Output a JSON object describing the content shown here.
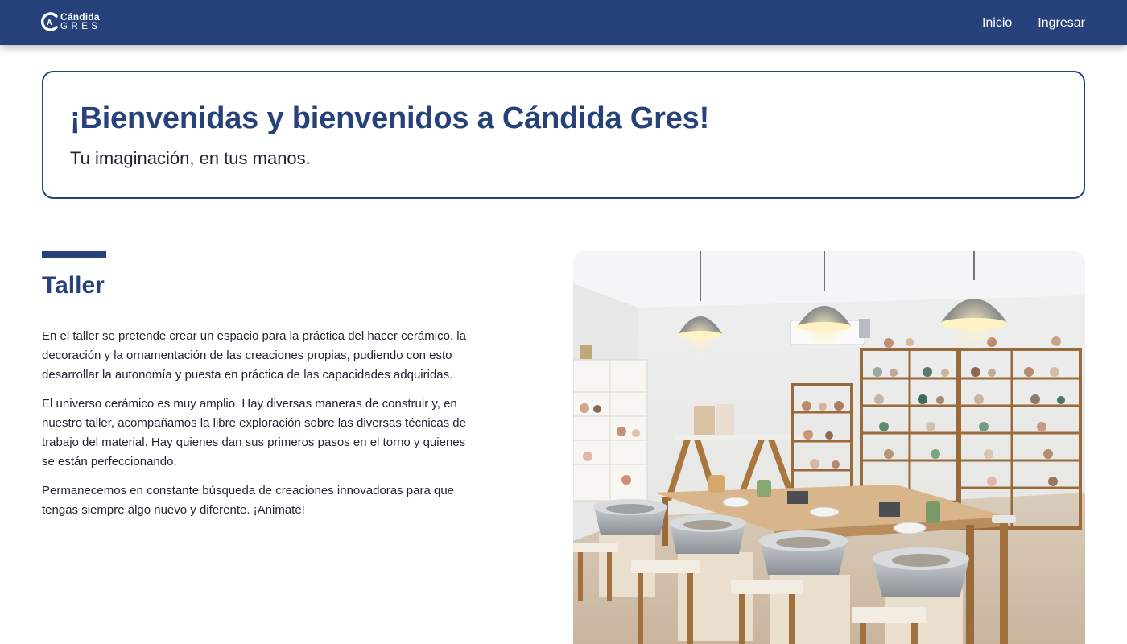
{
  "nav": {
    "logo_name": "Cándida",
    "logo_sub": "GRES",
    "links": [
      "Inicio",
      "Ingresar"
    ]
  },
  "hero": {
    "title": "¡Bienvenidas y bienvenidos a Cándida Gres!",
    "subtitle": "Tu imaginación, en tus manos."
  },
  "section": {
    "title": "Taller",
    "paragraphs": [
      "En el taller se pretende crear un espacio para la práctica del hacer cerámico, la decoración y la ornamentación de las creaciones propias, pudiendo con esto desarrollar la autonomía y puesta en práctica de las capacidades adquiridas.",
      "El universo cerámico es muy amplio. Hay diversas maneras de construir y, en nuestro taller, acompañamos la libre exploración sobre las diversas técnicas de trabajo del material. Hay quienes dan sus primeros pasos en el torno y quienes se están perfeccionando.",
      "Permanecemos en constante búsqueda de creaciones innovadoras para que tengas siempre algo nuevo y diferente. ¡Animate!"
    ]
  },
  "colors": {
    "brand": "#27427a",
    "text": "#1f2430",
    "background": "#ffffff"
  }
}
